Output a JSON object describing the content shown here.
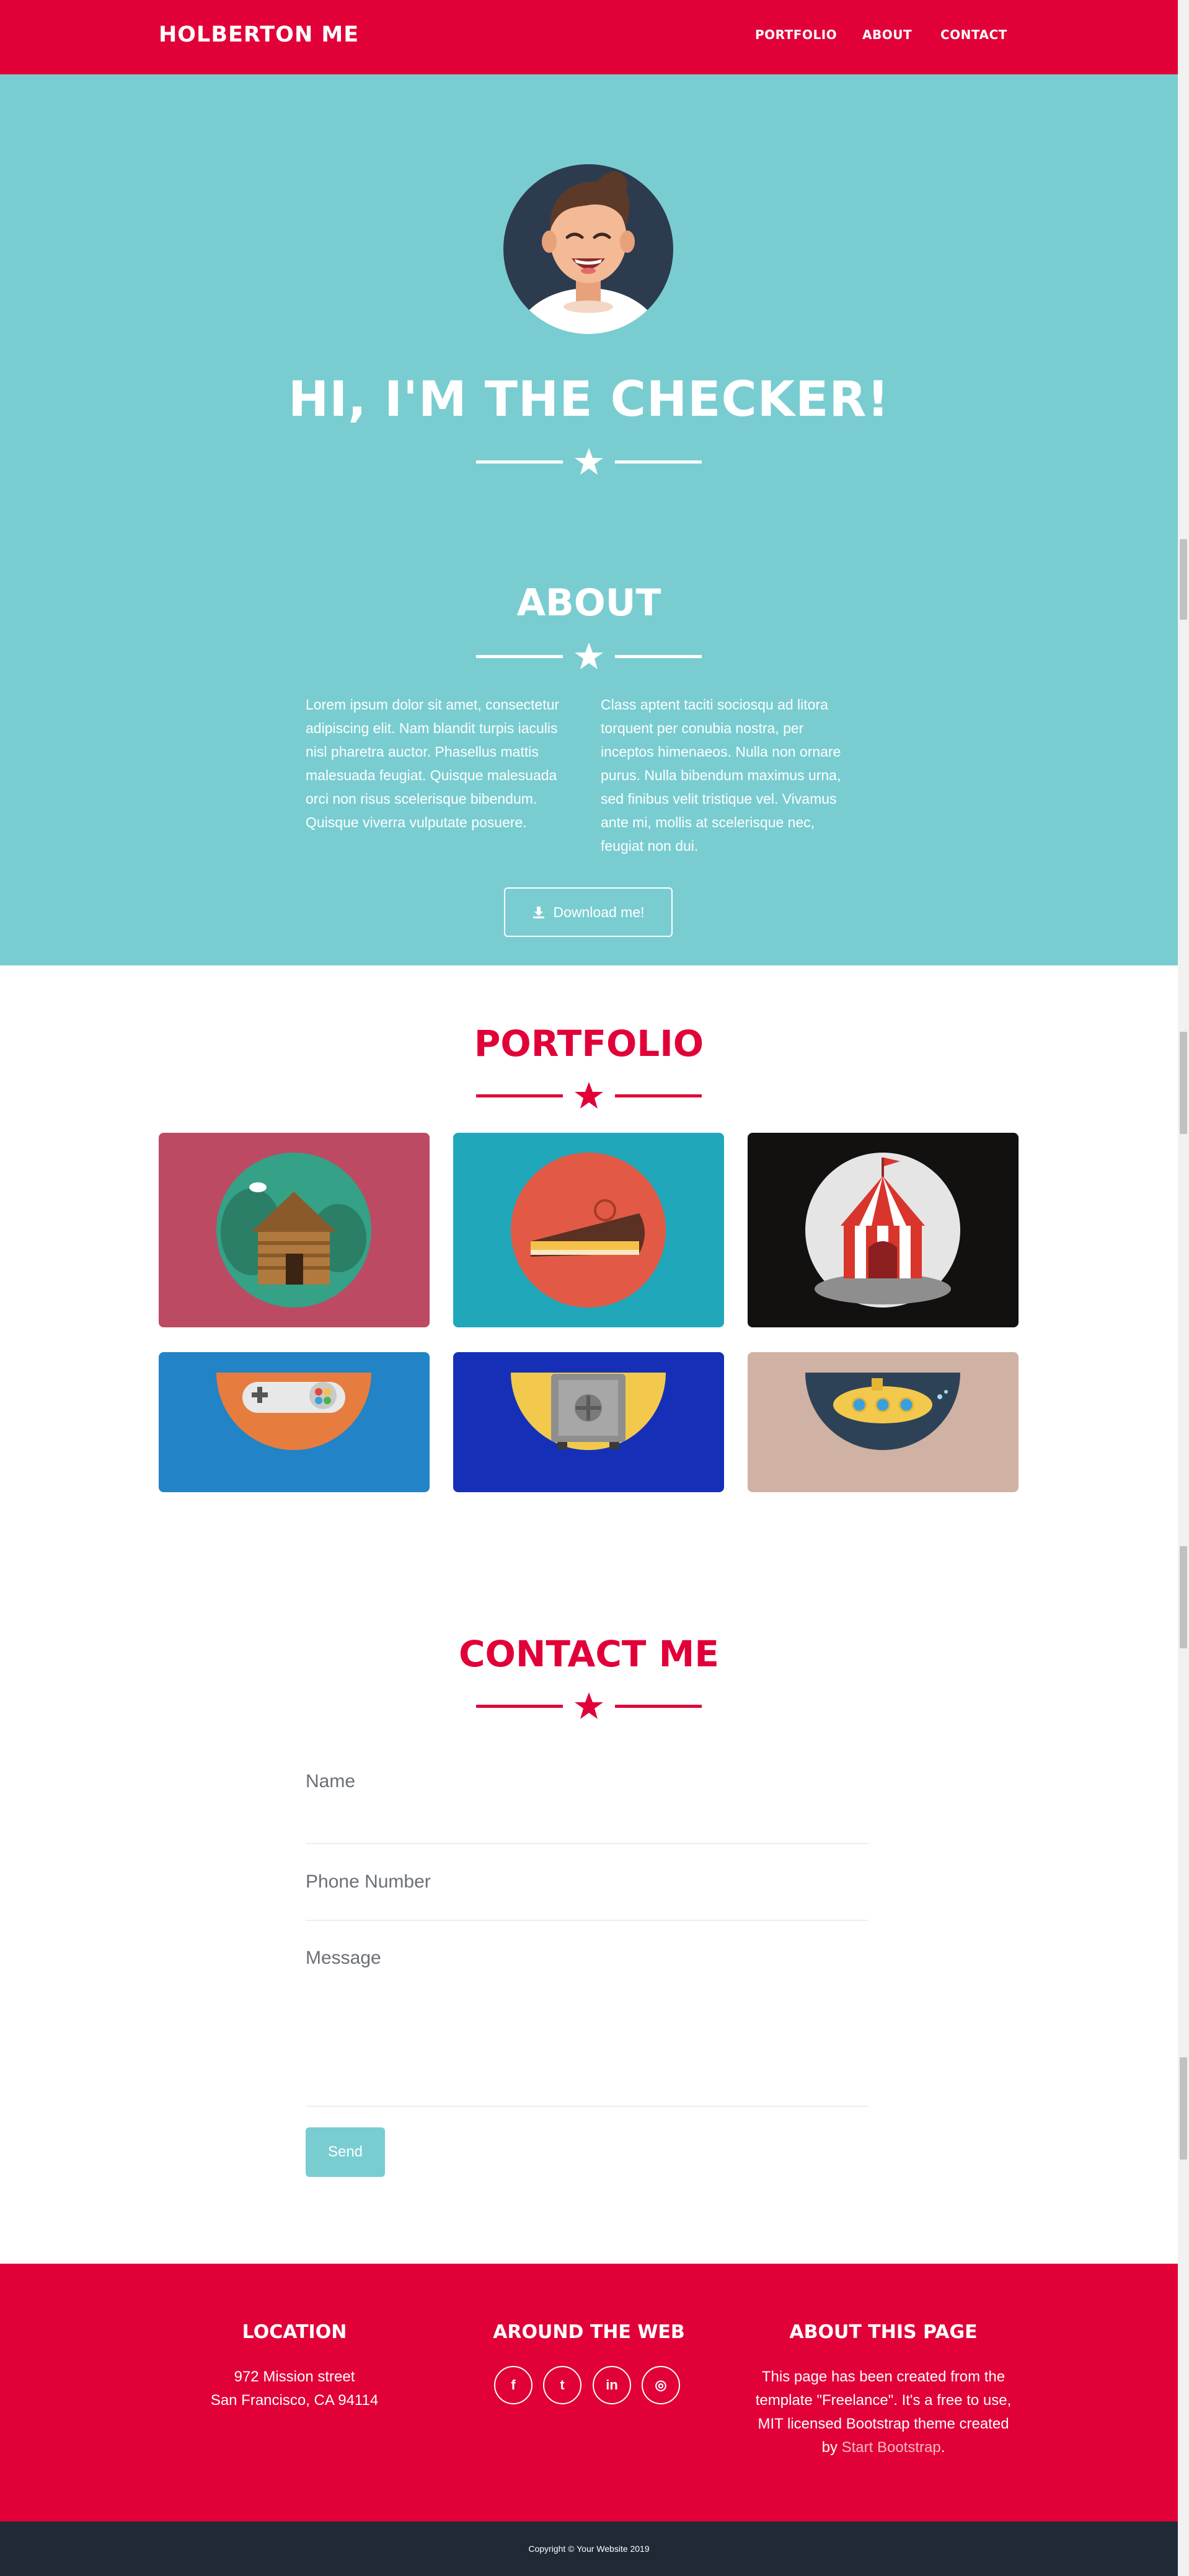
{
  "navbar": {
    "brand": "HOLBERTON ME",
    "links": [
      "PORTFOLIO",
      "ABOUT",
      "CONTACT"
    ]
  },
  "hero": {
    "title": "HI, I'M THE CHECKER!"
  },
  "about": {
    "title": "ABOUT",
    "col1": [
      "Lorem ipsum dolor sit amet, consectetur",
      "adipiscing elit. Nam blandit turpis iaculis",
      "nisl pharetra auctor. Phasellus mattis",
      "malesuada feugiat. Quisque malesuada",
      "orci non risus scelerisque bibendum.",
      "Quisque viverra vulputate posuere."
    ],
    "col2": [
      "Class aptent taciti sociosqu ad litora",
      "torquent per conubia nostra, per",
      "inceptos himenaeos. Nulla non ornare",
      "purus. Nulla bibendum maximus urna,",
      "sed finibus velit tristique vel. Vivamus",
      "ante mi, mollis at scelerisque nec,",
      "feugiat non dui."
    ],
    "download_label": "Download me!"
  },
  "portfolio": {
    "title": "PORTFOLIO",
    "tiles": [
      {
        "icon": "cabin-icon",
        "bg": "#bd4a63"
      },
      {
        "icon": "cake-icon",
        "bg": "#21a7ba"
      },
      {
        "icon": "circus-tent-icon",
        "bg": "#131010"
      },
      {
        "icon": "game-controller-icon",
        "bg": "#2283c6"
      },
      {
        "icon": "safe-icon",
        "bg": "#1530b7"
      },
      {
        "icon": "submarine-icon",
        "bg": "#cfb2a3"
      }
    ]
  },
  "contact": {
    "title": "CONTACT ME",
    "name_placeholder": "Name",
    "phone_placeholder": "Phone Number",
    "message_placeholder": "Message",
    "send_label": "Send"
  },
  "footer": {
    "location_title": "LOCATION",
    "address_line1": "972 Mission street",
    "address_line2": "San Francisco, CA 94114",
    "web_title": "AROUND THE WEB",
    "social": [
      {
        "icon": "facebook-icon",
        "glyph": "f"
      },
      {
        "icon": "twitter-icon",
        "glyph": "t"
      },
      {
        "icon": "linkedin-icon",
        "glyph": "in"
      },
      {
        "icon": "dribbble-icon",
        "glyph": "◎"
      }
    ],
    "about_title": "ABOUT THIS PAGE",
    "about_line1": "This page has been created from the",
    "about_line2": "template \"Freelance\". It's a free to use,",
    "about_line3": "MIT licensed Bootstrap theme created",
    "about_by": "by ",
    "about_link": "Start Bootstrap",
    "about_end": "."
  },
  "copyright": "Copyright © Your Website 2019",
  "colors": {
    "primary_red": "#e10038",
    "teal": "#79cdd1",
    "dark": "#1f2a36"
  }
}
